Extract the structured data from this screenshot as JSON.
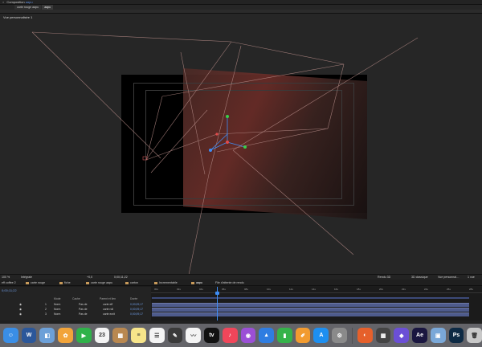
{
  "panel": {
    "close": "×",
    "title_prefix": "Composition",
    "title_accent": "aapu"
  },
  "comp_tabs": [
    "carte rouge aapu",
    "aapu"
  ],
  "viewer": {
    "view_label": "Vue personnalisée 1",
    "footer": {
      "zoom": "100 %",
      "quality": "Intégrale",
      "timecode_offset": "+0,0",
      "timecode": "0;00;11;22",
      "renderer": "Rendu 3D",
      "draft3d": "3D classique",
      "view": "Vue personnal…",
      "views": "1 vue"
    }
  },
  "timeline_tabs": [
    {
      "label": "eff coffee 2",
      "active": false
    },
    {
      "label": "carte rouge",
      "active": false
    },
    {
      "label": "fiche",
      "active": false
    },
    {
      "label": "carte rouge aapu",
      "active": false
    },
    {
      "label": "carton",
      "active": false
    },
    {
      "label": "Incrementable",
      "active": false
    },
    {
      "label": "aapu",
      "active": true
    },
    {
      "label": "File d'attente de rendu",
      "active": false
    }
  ],
  "timeline": {
    "columns": {
      "mode": "Mode",
      "trkmat": "Cache",
      "parent": "Parent et lien",
      "duration": "Durée"
    },
    "layers": [
      {
        "num": "1",
        "name": "carte eff",
        "mode": "Norm",
        "trk": "Pas de",
        "parent": "Aucun",
        "dur": "0;00;09;17"
      },
      {
        "num": "2",
        "name": "carte roll",
        "mode": "Norm",
        "trk": "Pas de",
        "parent": "Aucun",
        "dur": "0;00;09;17"
      },
      {
        "num": "3",
        "name": "carte ecrit",
        "mode": "Norm",
        "trk": "Pas de",
        "parent": "Aucun",
        "dur": "0;00;09;17"
      }
    ],
    "ruler_labels": [
      "00s",
      "02s",
      "04s",
      "06s",
      "08s",
      "10s",
      "12s",
      "14s",
      "16s",
      "18s",
      "20s",
      "22s",
      "24s",
      "26s",
      "28s"
    ]
  },
  "dock": [
    {
      "name": "finder",
      "color": "#3a8ee6",
      "glyph": "☺"
    },
    {
      "name": "word",
      "color": "#2b579a",
      "glyph": "W"
    },
    {
      "name": "preview",
      "color": "#6ca0d8",
      "glyph": "◧"
    },
    {
      "name": "photos",
      "color": "#f2a43a",
      "glyph": "✿"
    },
    {
      "name": "facetime",
      "color": "#2fb24a",
      "glyph": "▶"
    },
    {
      "name": "calendar",
      "color": "#f4f4f4",
      "glyph": "23"
    },
    {
      "name": "notes-wood",
      "color": "#b98850",
      "glyph": "▦"
    },
    {
      "name": "notes",
      "color": "#f7e58a",
      "glyph": "≡"
    },
    {
      "name": "reminders",
      "color": "#f4f4f4",
      "glyph": "☰"
    },
    {
      "name": "pencil",
      "color": "#3a3a3a",
      "glyph": "✎"
    },
    {
      "name": "freeform",
      "color": "#f4f4f4",
      "glyph": "〰"
    },
    {
      "name": "appletv",
      "color": "#111111",
      "glyph": "tv"
    },
    {
      "name": "music",
      "color": "#f0465a",
      "glyph": "♪"
    },
    {
      "name": "podcasts",
      "color": "#9b4fd6",
      "glyph": "◉"
    },
    {
      "name": "keynote",
      "color": "#2f7de1",
      "glyph": "▲"
    },
    {
      "name": "numbers",
      "color": "#35b34a",
      "glyph": "▮"
    },
    {
      "name": "pages",
      "color": "#f29b2f",
      "glyph": "✐"
    },
    {
      "name": "appstore",
      "color": "#1d8ff0",
      "glyph": "A"
    },
    {
      "name": "settings",
      "color": "#8a8a8a",
      "glyph": "⚙"
    },
    {
      "name": "firefox",
      "color": "#e6602b",
      "glyph": "◐"
    },
    {
      "name": "calculator",
      "color": "#444444",
      "glyph": "▦"
    },
    {
      "name": "affinity",
      "color": "#6b4fd6",
      "glyph": "◆"
    },
    {
      "name": "after-effects",
      "color": "#1a1640",
      "glyph": "Ae"
    },
    {
      "name": "preview-photo",
      "color": "#7aa8d8",
      "glyph": "▣"
    },
    {
      "name": "photoshop",
      "color": "#0d2a44",
      "glyph": "Ps"
    },
    {
      "name": "trash",
      "color": "#c8c8c8",
      "glyph": "🗑"
    }
  ]
}
